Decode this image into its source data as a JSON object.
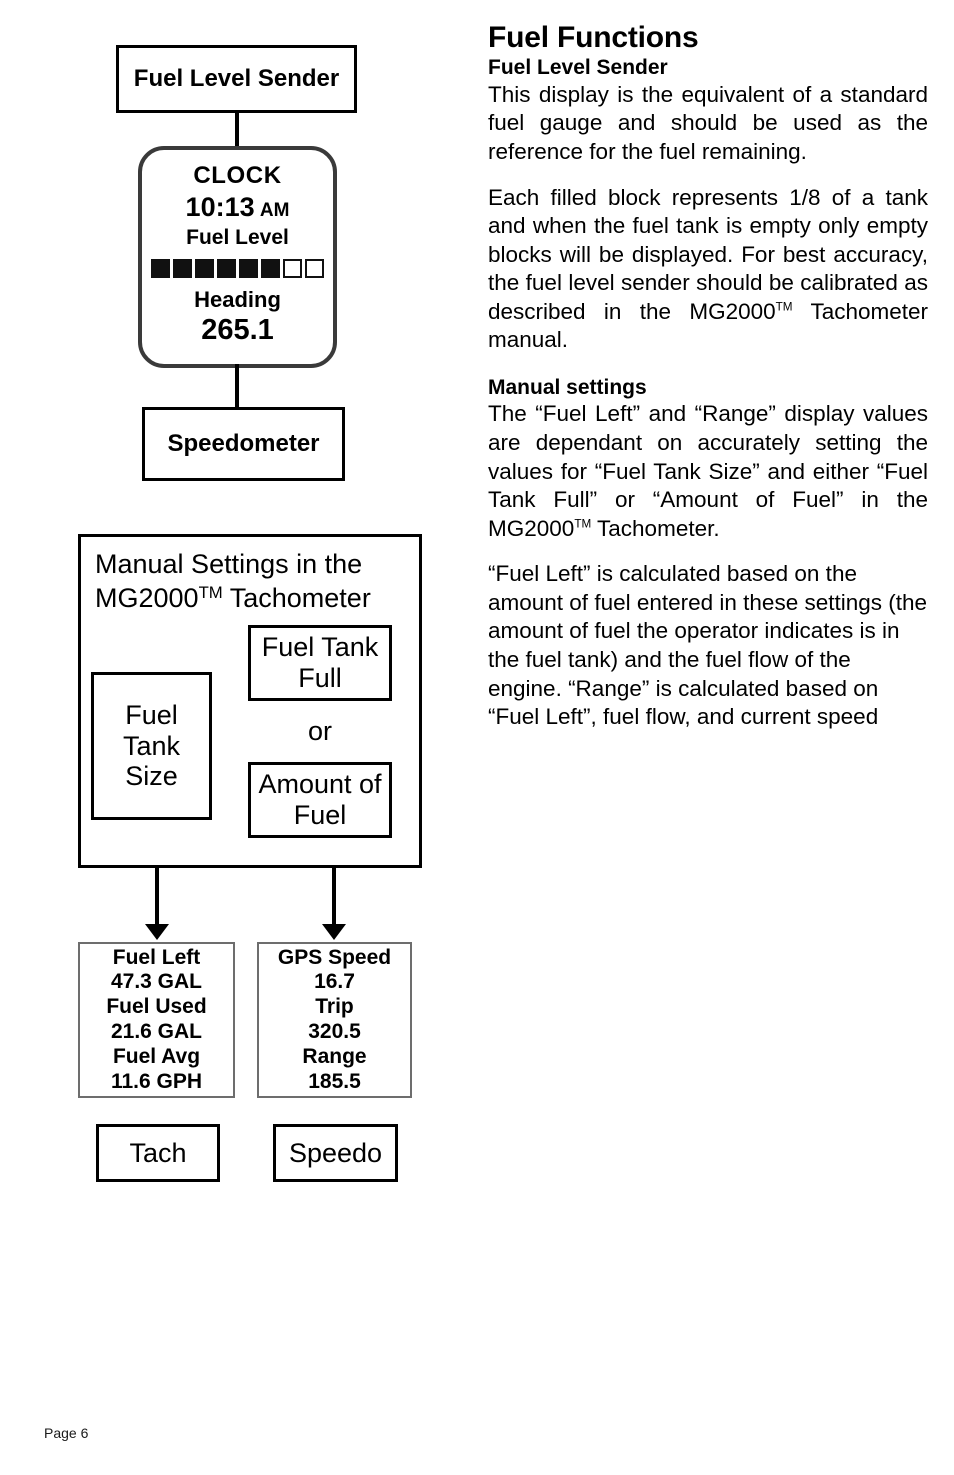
{
  "page": {
    "footer_label": "Page 6"
  },
  "diagram_top": {
    "sender_box_label": "Fuel Level Sender",
    "speedometer_box_label": "Speedometer",
    "screen": {
      "clock_label": "CLOCK",
      "time_value": "10:13",
      "time_meridiem": "AM",
      "fuel_level_label": "Fuel Level",
      "fuel_blocks_total": 8,
      "fuel_blocks_filled": 6,
      "heading_label": "Heading",
      "heading_value": "265.1"
    }
  },
  "diagram_manual": {
    "title_line1": "Manual Settings in the",
    "title_line2_model": "MG2000",
    "title_line2_tm": "TM",
    "title_line2_rest": " Tachometer",
    "tank_size_box_label": "Fuel Tank Size",
    "tank_full_box_label": "Fuel Tank Full",
    "or_label": "or",
    "amount_box_label": "Amount of Fuel"
  },
  "diagram_bottom": {
    "tach_panel": {
      "fuel_left_label": "Fuel Left",
      "fuel_left_value": "47.3 GAL",
      "fuel_used_label": "Fuel Used",
      "fuel_used_value": "21.6 GAL",
      "fuel_avg_label": "Fuel Avg",
      "fuel_avg_value": "11.6 GPH"
    },
    "speedo_panel": {
      "gps_speed_label": "GPS Speed",
      "gps_speed_value": "16.7",
      "trip_label": "Trip",
      "trip_value": "320.5",
      "range_label": "Range",
      "range_value": "185.5"
    },
    "tach_box_label": "Tach",
    "speedo_box_label": "Speedo"
  },
  "article": {
    "heading": "Fuel Functions",
    "subheading_1": "Fuel Level Sender",
    "paragraph_1": "This display is the equivalent of a standard fuel gauge and should be used as the reference for the fuel remaining.",
    "paragraph_2_a": "Each filled block represents 1/8 of a tank and when the fuel tank is empty only empty blocks will be displayed.  For best accuracy, the fuel level sender should be calibrated as described in the MG2000",
    "paragraph_2_tm": "TM",
    "paragraph_2_b": " Tachometer manual.",
    "subheading_2": "Manual settings",
    "paragraph_3_a": "The “Fuel Left” and “Range” display values are dependant on accurately setting the values for “Fuel Tank Size” and either “Fuel Tank Full” or “Amount of Fuel” in the MG2000",
    "paragraph_3_tm": "TM",
    "paragraph_3_b": "  Tachometer.",
    "paragraph_4": "“Fuel Left” is calculated based on the amount of fuel entered in these settings (the amount of fuel the operator indicates is in the fuel tank) and the fuel flow of the engine.  “Range” is calculated based on “Fuel Left”, fuel flow, and current speed"
  },
  "colors": {
    "ink": "#000000",
    "panel_border": "#6d6d6d",
    "screen_border": "#3a3a3a",
    "background": "#ffffff"
  }
}
